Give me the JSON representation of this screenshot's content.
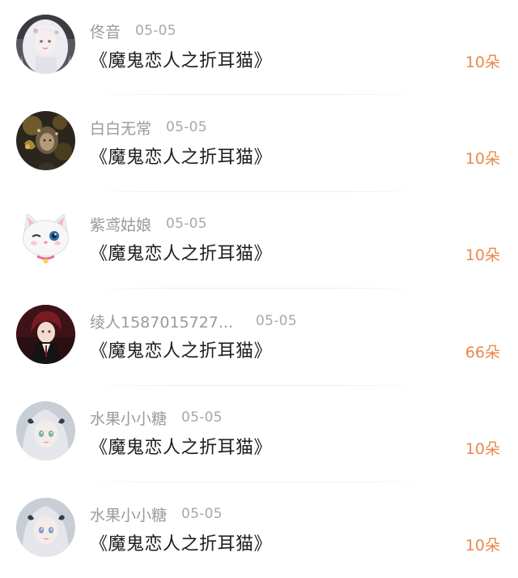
{
  "gift_list": {
    "items": [
      {
        "name": "佟音",
        "date": "05-05",
        "title": "《魔鬼恋人之折耳猫》",
        "gift": "10朵",
        "avatar": "avatar-white-hair-girl"
      },
      {
        "name": "白白无常",
        "date": "05-05",
        "title": "《魔鬼恋人之折耳猫》",
        "gift": "10朵",
        "avatar": "avatar-dark-gold-girl"
      },
      {
        "name": "紫鸢姑娘",
        "date": "05-05",
        "title": "《魔鬼恋人之折耳猫》",
        "gift": "10朵",
        "avatar": "avatar-white-cat"
      },
      {
        "name": "绫人1587015727...",
        "date": "05-05",
        "title": "《魔鬼恋人之折耳猫》",
        "gift": "66朵",
        "avatar": "avatar-red-hair-boy"
      },
      {
        "name": "水果小小糖",
        "date": "05-05",
        "title": "《魔鬼恋人之折耳猫》",
        "gift": "10朵",
        "avatar": "avatar-silver-hair-girl"
      },
      {
        "name": "水果小小糖",
        "date": "05-05",
        "title": "《魔鬼恋人之折耳猫》",
        "gift": "10朵",
        "avatar": "avatar-silver-hair-girl"
      }
    ]
  },
  "colors": {
    "gift_accent": "#e8894a",
    "name_gray": "#9a9a9a",
    "title_text": "#1e1e1e"
  }
}
